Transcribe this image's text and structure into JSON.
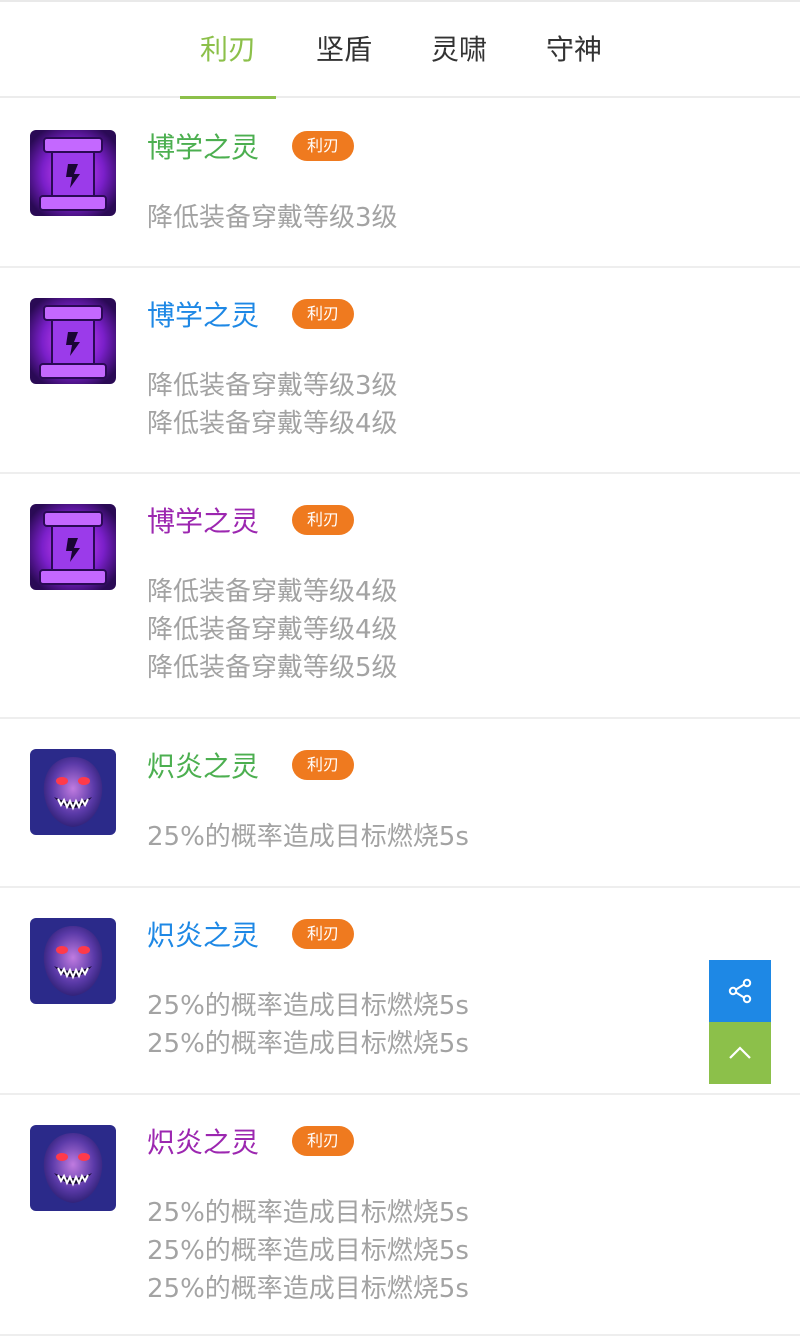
{
  "tabs": [
    {
      "label": "利刃",
      "active": true
    },
    {
      "label": "坚盾",
      "active": false
    },
    {
      "label": "灵啸",
      "active": false
    },
    {
      "label": "守神",
      "active": false
    }
  ],
  "items": [
    {
      "name": "博学之灵",
      "name_color": "#4caf50",
      "badge": "利刃",
      "icon": "purple-pillar-icon",
      "lines": [
        "降低装备穿戴等级3级"
      ]
    },
    {
      "name": "博学之灵",
      "name_color": "#1e88e5",
      "badge": "利刃",
      "icon": "purple-pillar-icon",
      "lines": [
        "降低装备穿戴等级3级",
        "降低装备穿戴等级4级"
      ]
    },
    {
      "name": "博学之灵",
      "name_color": "#9c27b0",
      "badge": "利刃",
      "icon": "purple-pillar-icon",
      "lines": [
        "降低装备穿戴等级4级",
        "降低装备穿戴等级4级",
        "降低装备穿戴等级5级"
      ]
    },
    {
      "name": "炽炎之灵",
      "name_color": "#4caf50",
      "badge": "利刃",
      "icon": "flame-ghost-icon",
      "lines": [
        "25%的概率造成目标燃烧5s"
      ]
    },
    {
      "name": "炽炎之灵",
      "name_color": "#1e88e5",
      "badge": "利刃",
      "icon": "flame-ghost-icon",
      "lines": [
        "25%的概率造成目标燃烧5s",
        "25%的概率造成目标燃烧5s"
      ]
    },
    {
      "name": "炽炎之灵",
      "name_color": "#9c27b0",
      "badge": "利刃",
      "icon": "flame-ghost-icon",
      "lines": [
        "25%的概率造成目标燃烧5s",
        "25%的概率造成目标燃烧5s",
        "25%的概率造成目标燃烧5s"
      ]
    }
  ],
  "floating": {
    "share_icon": "share-icon",
    "top_icon": "chevron-up-icon",
    "share_color": "#1e88e5",
    "top_color": "#8cc04a"
  }
}
